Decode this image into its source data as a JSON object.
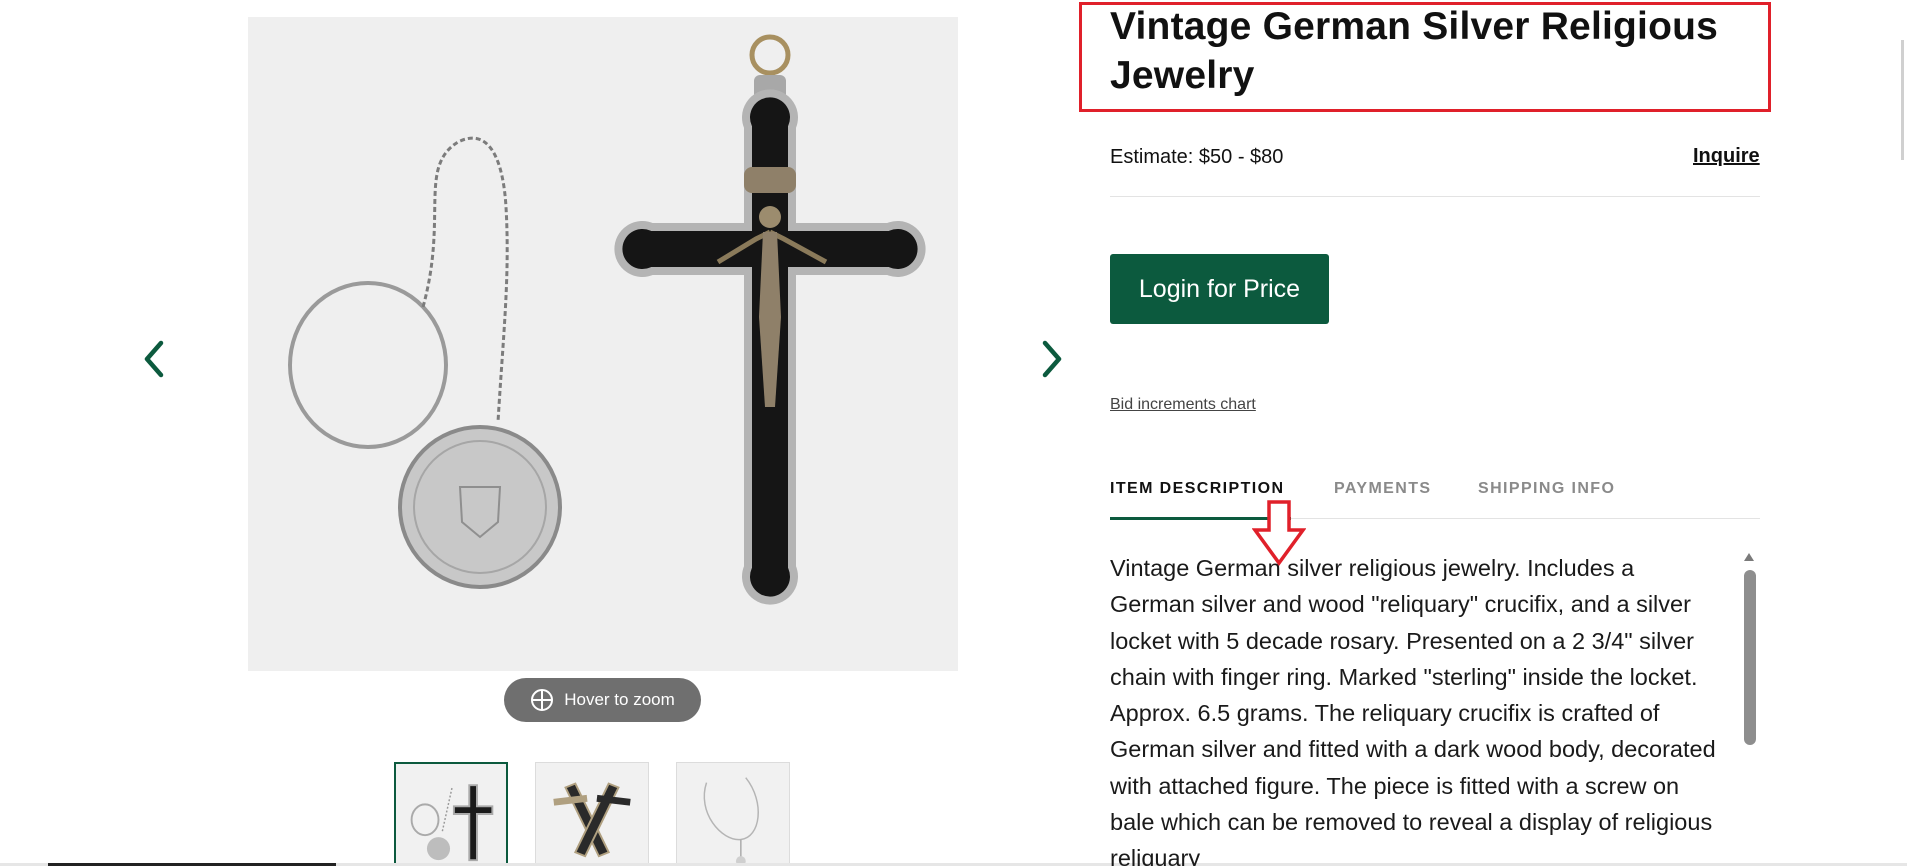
{
  "product": {
    "title": "Vintage German Silver Religious Jewelry",
    "estimate": "Estimate: $50 - $80",
    "inquire_label": "Inquire",
    "login_label": "Login for Price",
    "bid_link": "Bid increments chart"
  },
  "gallery": {
    "zoom_label": "Hover to zoom",
    "thumbnail_count": 3
  },
  "tabs": [
    {
      "label": "ITEM DESCRIPTION",
      "active": true
    },
    {
      "label": "PAYMENTS",
      "active": false
    },
    {
      "label": "SHIPPING INFO",
      "active": false
    }
  ],
  "description": "Vintage German silver religious jewelry. Includes a German silver and wood \"reliquary\" crucifix, and a silver locket with 5 decade rosary. Presented on a 2 3/4\" silver chain with finger ring. Marked \"sterling\" inside the locket. Approx. 6.5 grams. The reliquary crucifix is crafted of German silver and fitted with a dark wood body, decorated with attached figure. The piece is fitted with a screw on bale which can be removed to reveal a display of religious reliquary",
  "colors": {
    "accent": "#0c5a3e",
    "annotation": "#e0202a",
    "scrollbar": "#8e8e8e"
  },
  "icons": {
    "prev": "chevron-left-icon",
    "next": "chevron-right-icon",
    "zoom": "crosshair-circle-icon",
    "annotation_arrow": "down-arrow-icon"
  }
}
